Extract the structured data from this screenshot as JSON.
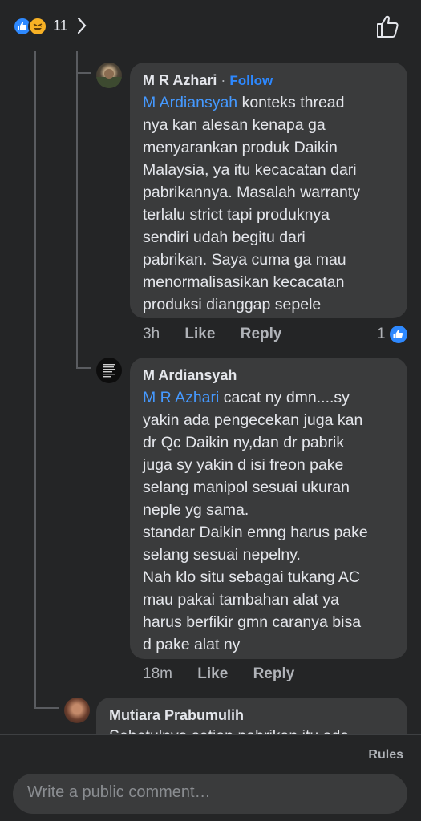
{
  "reactions": {
    "count": "11",
    "types": [
      "like-icon",
      "haha-icon"
    ]
  },
  "comments": [
    {
      "author": "M R Azhari",
      "separator": "·",
      "follow_label": "Follow",
      "mention": "M R Azhari",
      "mention_tagged": "M Ardiansyah",
      "text": " konteks thread\nnya kan alesan kenapa ga\nmenyarankan produk Daikin\nMalaysia, ya itu kecacatan dari\npabrikannya. Masalah warranty\nterlalu strict tapi produknya\nsendiri udah begitu dari\npabrikan. Saya cuma ga mau\nmenormalisasikan kecacatan\nproduksi dianggap sepele",
      "time": "3h",
      "like_label": "Like",
      "reply_label": "Reply",
      "reaction_count": "1"
    },
    {
      "author": "M Ardiansyah",
      "mention_tagged": "M R Azhari",
      "text": " cacat ny dmn....sy\nyakin ada pengecekan juga kan\ndr Qc Daikin ny,dan dr pabrik\njuga sy yakin d isi freon pake\nselang manipol sesuai ukuran\nneple yg sama.\nstandar Daikin emng harus pake\nselang sesuai nepelny.\nNah klo situ sebagai tukang AC\nmau pakai tambahan alat ya\nharus berfikir gmn caranya bisa\nd pake alat ny",
      "time": "18m",
      "like_label": "Like",
      "reply_label": "Reply"
    },
    {
      "author": "Mutiara  Prabumulih",
      "text": "Sebetulnya setiap pabrikan itu ada"
    }
  ],
  "footer": {
    "rules_label": "Rules",
    "comment_placeholder": "Write a public comment…"
  }
}
